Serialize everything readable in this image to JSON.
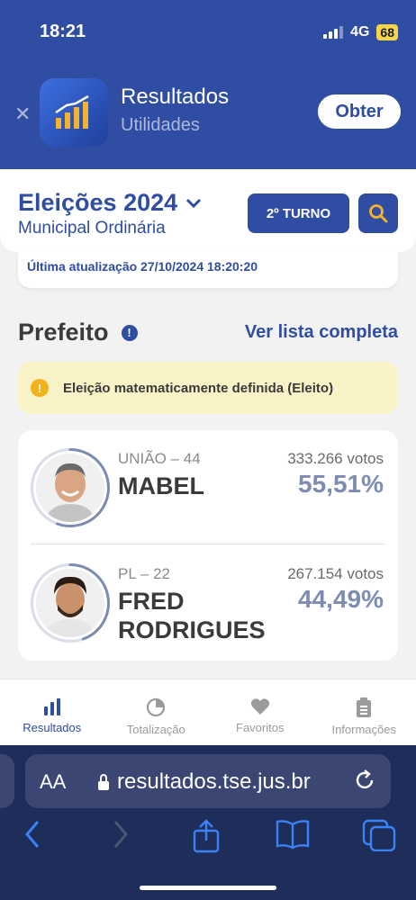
{
  "status_bar": {
    "time": "18:21",
    "network": "4G",
    "battery": "68"
  },
  "app_banner": {
    "name": "Resultados",
    "subtitle": "Utilidades",
    "button_label": "Obter"
  },
  "header": {
    "title": "Eleições 2024",
    "subtitle": "Municipal Ordinária",
    "turno_label": "2º TURNO"
  },
  "last_update": "Última atualização 27/10/2024 18:20:20",
  "section": {
    "title": "Prefeito",
    "see_all": "Ver lista completa"
  },
  "alert": "Eleição matematicamente definida (Eleito)",
  "candidates": [
    {
      "party": "UNIÃO – 44",
      "name": "MABEL",
      "votes": "333.266 votos",
      "percent": "55,51%",
      "share": 0.5551
    },
    {
      "party": "PL – 22",
      "name": "FRED RODRIGUES",
      "votes": "267.154 votos",
      "percent": "44,49%",
      "share": 0.4449
    }
  ],
  "tabs": [
    {
      "label": "Resultados",
      "icon": "bar-chart-icon",
      "active": true
    },
    {
      "label": "Totalização",
      "icon": "pie-chart-icon",
      "active": false
    },
    {
      "label": "Favoritos",
      "icon": "heart-icon",
      "active": false
    },
    {
      "label": "Informações",
      "icon": "clipboard-icon",
      "active": false
    }
  ],
  "browser": {
    "url": "resultados.tse.jus.br",
    "text_size_label": "AA"
  },
  "colors": {
    "primary": "#2f4da3",
    "alert_bg": "#fbf3c8",
    "percent": "#7d8cb0"
  }
}
